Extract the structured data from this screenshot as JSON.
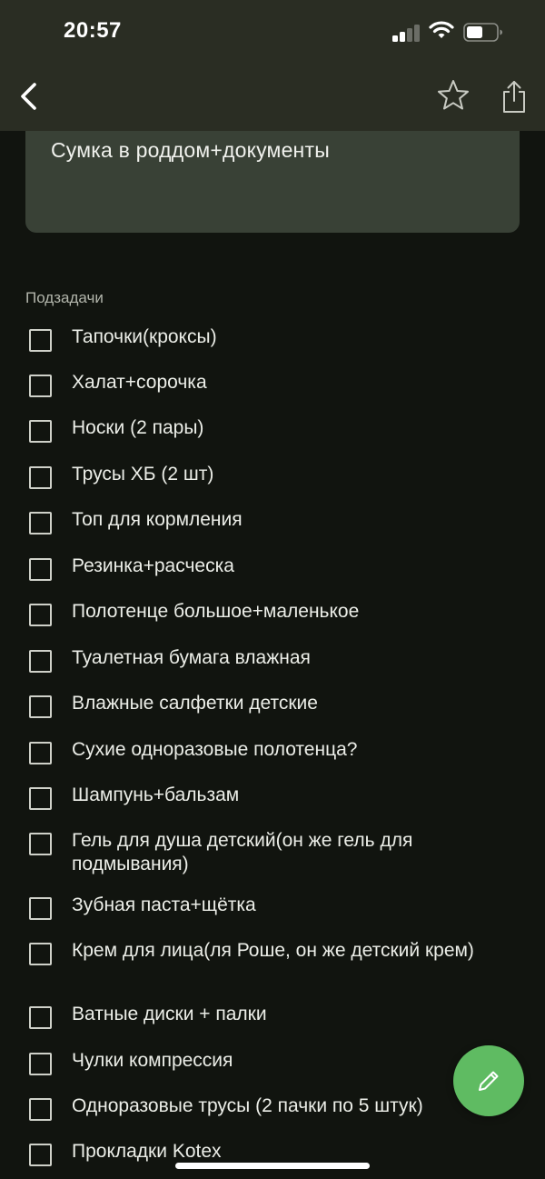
{
  "status_bar": {
    "time": "20:57",
    "icons": [
      "cellular-signal-icon",
      "wifi-icon",
      "battery-icon"
    ]
  },
  "nav": {
    "back_icon": "chevron-left-icon",
    "star_icon": "star-outline-icon",
    "share_icon": "share-icon"
  },
  "task": {
    "title": "Сумка в роддом+документы"
  },
  "subtasks_label": "Подзадачи",
  "subtasks": [
    {
      "label": "Тапочки(кроксы)",
      "checked": false
    },
    {
      "label": "Халат+сорочка",
      "checked": false
    },
    {
      "label": "Носки (2 пары)",
      "checked": false
    },
    {
      "label": "Трусы ХБ (2 шт)",
      "checked": false
    },
    {
      "label": "Топ для кормления",
      "checked": false
    },
    {
      "label": "Резинка+расческа",
      "checked": false
    },
    {
      "label": "Полотенце большое+маленькое",
      "checked": false
    },
    {
      "label": "Туалетная бумага влажная",
      "checked": false
    },
    {
      "label": "Влажные салфетки детские",
      "checked": false
    },
    {
      "label": "Сухие одноразовые полотенца?",
      "checked": false
    },
    {
      "label": "Шампунь+бальзам",
      "checked": false
    },
    {
      "label": "Гель для душа детский(он же гель для подмывания)",
      "checked": false
    },
    {
      "label": "Зубная паста+щётка",
      "checked": false
    },
    {
      "label": "Крем для лица(ля Роше, он же детский крем)",
      "checked": false
    },
    {
      "label": "Ватные диски + палки",
      "checked": false
    },
    {
      "label": "Чулки компрессия",
      "checked": false
    },
    {
      "label": "Одноразовые трусы (2 пачки по 5 штук)",
      "checked": false
    },
    {
      "label": "Прокладки Kotex",
      "checked": false
    }
  ],
  "fab": {
    "icon": "pencil-icon"
  },
  "colors": {
    "background": "#11140f",
    "header": "#2a2d23",
    "card": "#394136",
    "accent_green": "#5fbb62"
  }
}
